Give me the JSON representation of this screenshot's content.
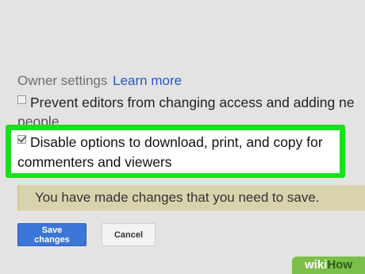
{
  "owner_settings": {
    "heading": "Owner settings",
    "learn_more": "Learn more"
  },
  "options": {
    "prevent_editors": {
      "line1": "Prevent editors from changing access and adding ne",
      "line2": "people",
      "checked": false
    },
    "disable_download": {
      "line1": "Disable options to download, print, and copy for",
      "line2": "commenters and viewers",
      "checked": true
    }
  },
  "warning": {
    "text": "You have made changes that you need to save."
  },
  "buttons": {
    "save": "Save changes",
    "cancel": "Cancel"
  },
  "watermark": {
    "part1": "wiki",
    "part2": "How"
  },
  "colors": {
    "highlight": "#19e01c",
    "link": "#2a56c6",
    "save_button": "#3c76d6",
    "warning_bg": "#d9d3ad"
  }
}
